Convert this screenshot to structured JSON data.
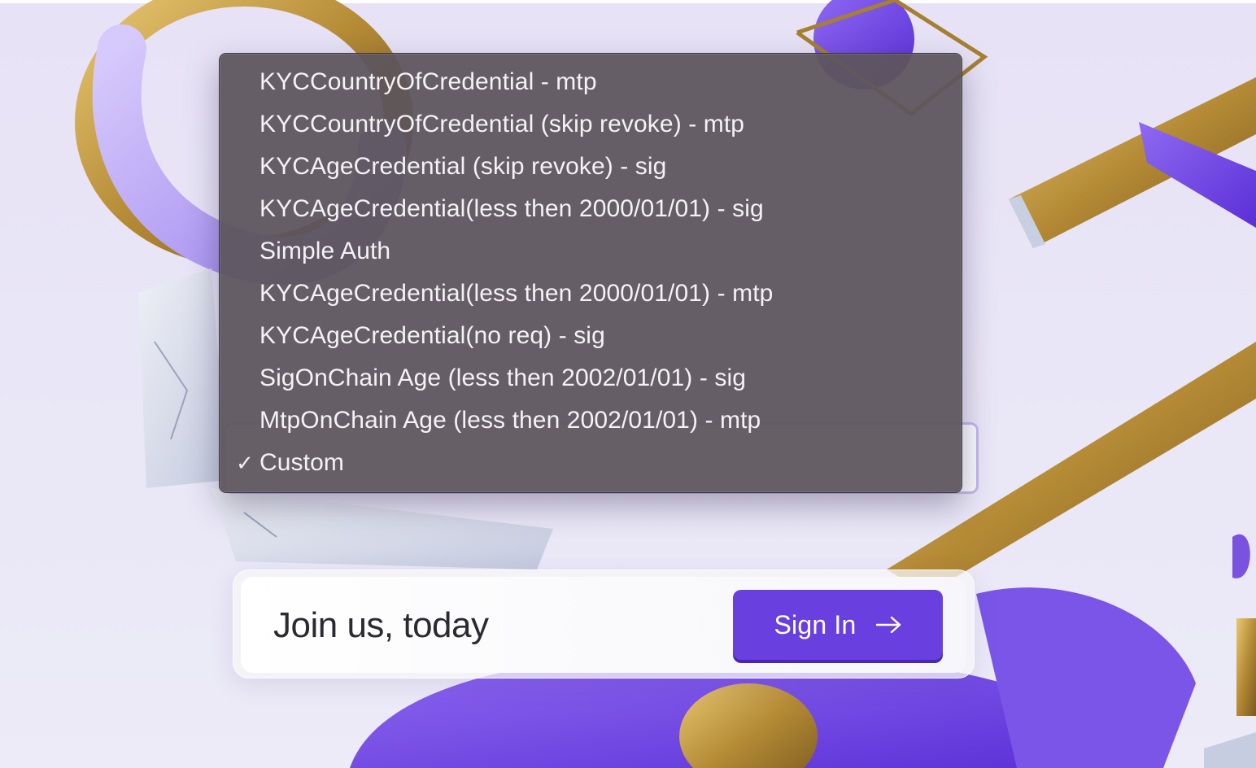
{
  "dropdown": {
    "items": [
      {
        "label": "KYCCountryOfCredential - mtp",
        "checked": false
      },
      {
        "label": "KYCCountryOfCredential (skip revoke) - mtp",
        "checked": false
      },
      {
        "label": "KYCAgeCredential (skip revoke) - sig",
        "checked": false
      },
      {
        "label": "KYCAgeCredential(less then 2000/01/01) - sig",
        "checked": false
      },
      {
        "label": "Simple Auth",
        "checked": false
      },
      {
        "label": "KYCAgeCredential(less then 2000/01/01) - mtp",
        "checked": false
      },
      {
        "label": "KYCAgeCredential(no req) - sig",
        "checked": false
      },
      {
        "label": "SigOnChain Age (less then 2002/01/01) - sig",
        "checked": false
      },
      {
        "label": "MtpOnChain Age (less then 2002/01/01) - mtp",
        "checked": false
      },
      {
        "label": "Custom",
        "checked": true
      }
    ],
    "check_mark": "✓",
    "selected_value": "Custom"
  },
  "join": {
    "text": "Join us, today",
    "button_label": "Sign In",
    "button_icon": "arrow-right-icon"
  },
  "colors": {
    "accent": "#6a3fe0",
    "menu_background": "#5c555c",
    "menu_text": "#f4f2f5"
  }
}
